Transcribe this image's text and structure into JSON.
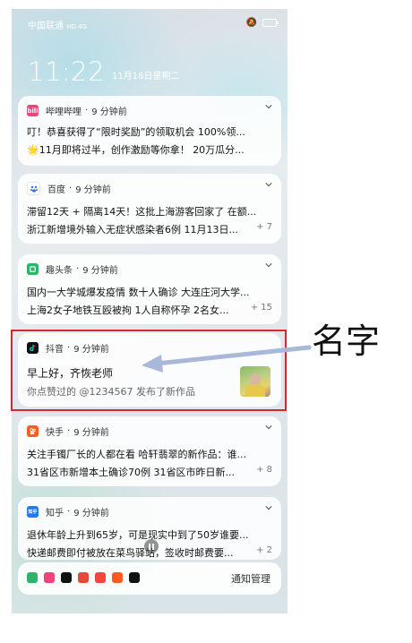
{
  "status_bar": {
    "carrier": "中国联通",
    "network": "HD 4G"
  },
  "lock_screen": {
    "time": "11:22",
    "date": "11月16日星期二"
  },
  "notifications": [
    {
      "app": "哔哩哔哩",
      "time_ago": "9 分钟前",
      "icon_color": "#f0437c",
      "icon_text": "bili",
      "lines": [
        {
          "text": "叮！恭喜获得了“限时奖励”的领取机会 100%领...",
          "extra": ""
        },
        {
          "text": "🌟11月即将过半，创作激励等你拿！ 20万瓜分...",
          "extra": ""
        }
      ]
    },
    {
      "app": "百度",
      "time_ago": "9 分钟前",
      "icon_color": "#2f6fe4",
      "icon_text": "",
      "lines": [
        {
          "text": "滞留12天 + 隔离14天！这批上海游客回家了 在额...",
          "extra": ""
        },
        {
          "text": "浙江新增境外输入无症状感染者6例 11月13日...",
          "extra": "+ 7"
        }
      ]
    },
    {
      "app": "趣头条",
      "time_ago": "9 分钟前",
      "icon_color": "#2fb36b",
      "icon_text": "",
      "lines": [
        {
          "text": "国内一大学城爆发疫情 数十人确诊 大连庄河大学...",
          "extra": ""
        },
        {
          "text": "上海2女子地铁互殴被拘 1人自称怀孕 2名女...",
          "extra": "+ 15"
        }
      ]
    },
    {
      "app": "抖音",
      "time_ago": "9 分钟前",
      "icon_color": "#111111",
      "icon_text": "",
      "lines": [
        {
          "text": "早上好，齐恢老师",
          "extra": ""
        },
        {
          "text": "你点赞过的 @1234567 发布了新作品",
          "extra": ""
        }
      ]
    },
    {
      "app": "快手",
      "time_ago": "9 分钟前",
      "icon_color": "#ff5a1f",
      "icon_text": "",
      "lines": [
        {
          "text": "关注手镯厂长的人都在看 哈轩翡翠的新作品：谁...",
          "extra": ""
        },
        {
          "text": "31省区市新增本土确诊70例 31省区市昨日新...",
          "extra": "+ 8"
        }
      ]
    },
    {
      "app": "知乎",
      "time_ago": "9 分钟前",
      "icon_color": "#1e7cf0",
      "icon_text": "知乎",
      "lines": [
        {
          "text": "退休年龄上升到65岁，可是现实中到了50岁谁要...",
          "extra": ""
        },
        {
          "text": "快递邮费即付被放在菜鸟驿站，签收时邮费要...",
          "extra": "+ 2"
        }
      ]
    }
  ],
  "dock": {
    "manage_label": "通知管理"
  },
  "annotation": {
    "label": "名字"
  },
  "colors": {
    "highlight": "#d9272e",
    "arrow": "#a9b7d8"
  }
}
